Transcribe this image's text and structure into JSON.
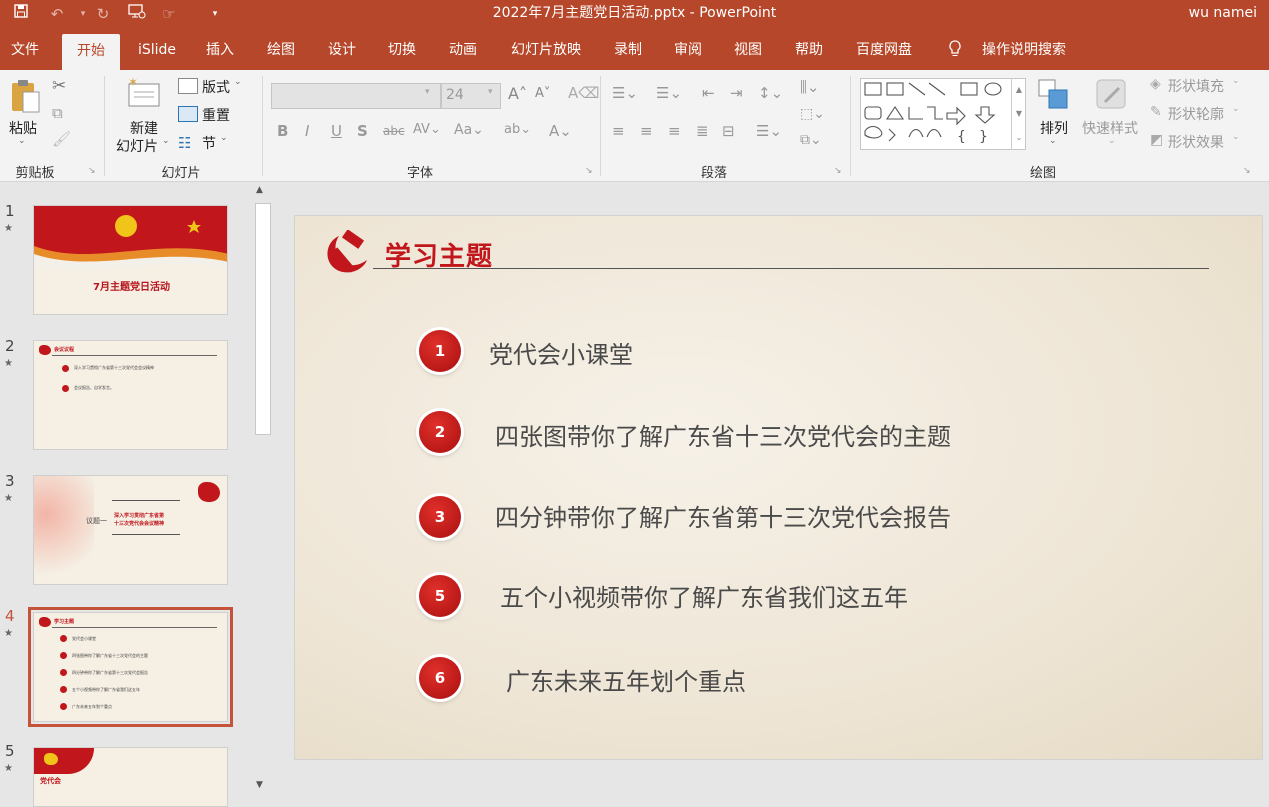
{
  "window": {
    "title": "2022年7月主题党日活动.pptx - PowerPoint",
    "user": "wu namei"
  },
  "tabs": [
    "文件",
    "开始",
    "iSlide",
    "插入",
    "绘图",
    "设计",
    "切换",
    "动画",
    "幻灯片放映",
    "录制",
    "审阅",
    "视图",
    "帮助",
    "百度网盘"
  ],
  "tell_me": "操作说明搜索",
  "ribbon": {
    "clipboard": {
      "paste": "粘贴",
      "group": "剪贴板"
    },
    "slides": {
      "new_slide": "新建",
      "new_slide2": "幻灯片",
      "layout": "版式",
      "reset": "重置",
      "section": "节",
      "group": "幻灯片"
    },
    "font": {
      "size": "24",
      "group": "字体"
    },
    "paragraph": {
      "group": "段落"
    },
    "drawing": {
      "arrange": "排列",
      "quick_styles": "快速样式",
      "fill": "形状填充",
      "outline": "形状轮廓",
      "effects": "形状效果",
      "group": "绘图"
    }
  },
  "thumbs": [
    {
      "num": "1",
      "title": "7月主题党日活动"
    },
    {
      "num": "2",
      "header": "会议议程",
      "items": [
        "深入学习贯彻广东省第十三次党代会会议精神",
        "会议报告、自学发言。"
      ]
    },
    {
      "num": "3",
      "label": "议题一",
      "title": "深入学习贯彻广东省第",
      "title2": "十三次党代会会议精神"
    },
    {
      "num": "4",
      "header": "学习主题",
      "items": [
        "党代会小课堂",
        "四张图带你了解广东省十三次党代会的主题",
        "四分钟带你了解广东省第十三次党代会报告",
        "五个小视频带你了解广东省我们这五年",
        "广东未来五年划个重点"
      ]
    },
    {
      "num": "5",
      "header": "党代会"
    }
  ],
  "slide": {
    "title": "学习主题",
    "items": [
      {
        "num": "1",
        "text": "党代会小课堂"
      },
      {
        "num": "2",
        "text": "四张图带你了解广东省十三次党代会的主题"
      },
      {
        "num": "3",
        "text": "四分钟带你了解广东省第十三次党代会报告"
      },
      {
        "num": "5",
        "text": "五个小视频带你了解广东省我们这五年"
      },
      {
        "num": "6",
        "text": "广东未来五年划个重点"
      }
    ]
  },
  "colors": {
    "accent": "#b7472a",
    "party_red": "#c1161b"
  }
}
